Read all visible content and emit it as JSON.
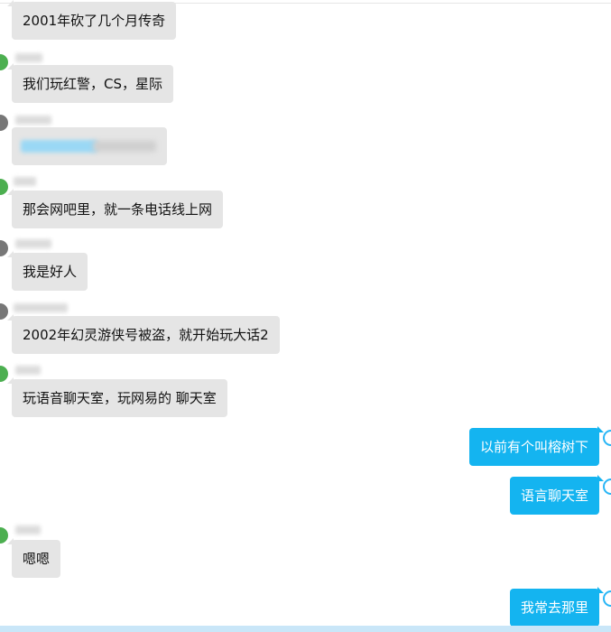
{
  "colors": {
    "incoming_bubble": "#e5e5e5",
    "outgoing_bubble": "#14b4f0",
    "avatar_green": "#4caf50",
    "avatar_gray": "#777777",
    "avatar_outline": "#29b6f6"
  },
  "messages": [
    {
      "direction": "incoming",
      "text": "2001年砍了几个月传奇"
    },
    {
      "direction": "incoming",
      "text": "我们玩红警，CS，星际"
    },
    {
      "direction": "incoming",
      "text": ""
    },
    {
      "direction": "incoming",
      "text": "那会网吧里，就一条电话线上网"
    },
    {
      "direction": "incoming",
      "text": "我是好人"
    },
    {
      "direction": "incoming",
      "text": "2002年幻灵游侠号被盗，就开始玩大话2"
    },
    {
      "direction": "incoming",
      "text": "玩语音聊天室，玩网易的 聊天室"
    },
    {
      "direction": "outgoing",
      "text": "以前有个叫榕树下"
    },
    {
      "direction": "outgoing",
      "text": "语言聊天室"
    },
    {
      "direction": "incoming",
      "text": "嗯嗯"
    },
    {
      "direction": "outgoing",
      "text": "我常去那里"
    }
  ]
}
